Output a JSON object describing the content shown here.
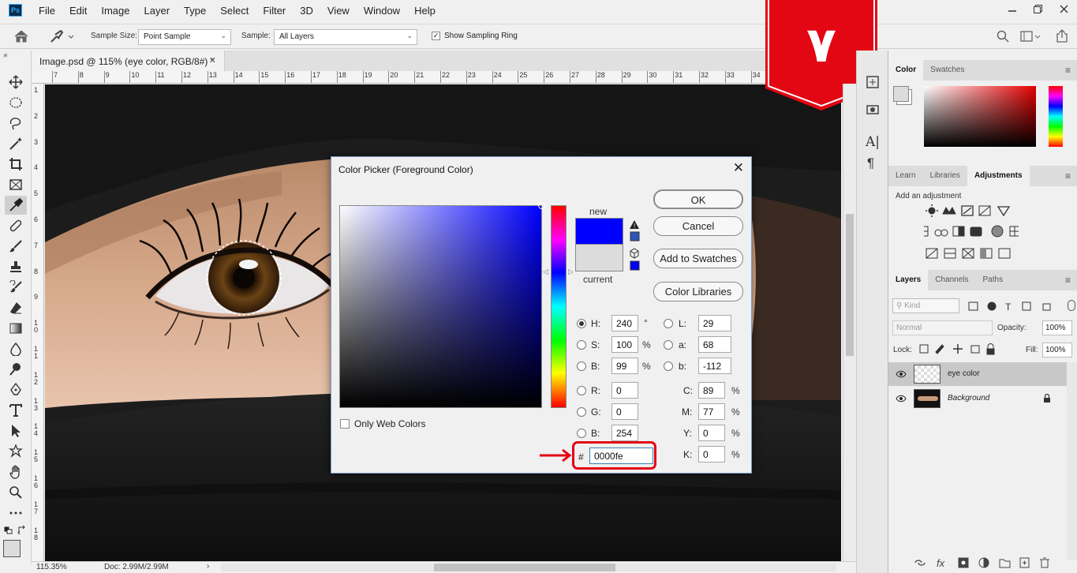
{
  "menubar": {
    "app_icon": "Ps",
    "items": [
      "File",
      "Edit",
      "Image",
      "Layer",
      "Type",
      "Select",
      "Filter",
      "3D",
      "View",
      "Window",
      "Help"
    ]
  },
  "options_bar": {
    "sample_size_label": "Sample Size:",
    "sample_size_value": "Point Sample",
    "sample_label": "Sample:",
    "sample_value": "All Layers",
    "show_ring_label": "Show Sampling Ring",
    "show_ring_checked": true
  },
  "document": {
    "tab_title": "Image.psd @ 115% (eye color, RGB/8#) *",
    "ruler_top": [
      "7",
      "8",
      "9",
      "10",
      "11",
      "12",
      "13",
      "14",
      "15",
      "16",
      "17",
      "18",
      "19",
      "20",
      "21",
      "22",
      "23",
      "24",
      "25",
      "26",
      "27",
      "28",
      "29",
      "30",
      "31",
      "32",
      "33",
      "34"
    ],
    "ruler_left": [
      "1",
      "2",
      "3",
      "4",
      "5",
      "6",
      "7",
      "8",
      "9",
      "10",
      "11",
      "12",
      "13",
      "14",
      "15",
      "16",
      "17",
      "18"
    ],
    "zoom": "115.35%",
    "doc_size": "Doc: 2.99M/2.99M"
  },
  "badge": {
    "text": "۷",
    "color": "#e30613"
  },
  "color_picker": {
    "title": "Color Picker (Foreground Color)",
    "ok": "OK",
    "cancel": "Cancel",
    "add_to_swatches": "Add to Swatches",
    "color_libraries": "Color Libraries",
    "new_label": "new",
    "current_label": "current",
    "new_color": "#0000fe",
    "current_color": "#dcdcdc",
    "only_web_colors": "Only Web Colors",
    "hsb": {
      "H": "240",
      "S": "100",
      "B": "99"
    },
    "rgb": {
      "R": "0",
      "G": "0",
      "B": "254"
    },
    "lab": {
      "L": "29",
      "a": "68",
      "b": "-112"
    },
    "cmyk": {
      "C": "89",
      "M": "77",
      "Y": "0",
      "K": "0"
    },
    "hex": "0000fe",
    "deg": "°",
    "pct": "%"
  },
  "panels": {
    "color_tabs": [
      "Color",
      "Swatches"
    ],
    "adj_tabs": [
      "Learn",
      "Libraries",
      "Adjustments"
    ],
    "add_adjustment": "Add an adjustment",
    "layers_tabs": [
      "Layers",
      "Channels",
      "Paths"
    ],
    "kind_placeholder": "Kind",
    "blend_mode": "Normal",
    "opacity_label": "Opacity:",
    "opacity_value": "100%",
    "lock_label": "Lock:",
    "fill_label": "Fill:",
    "fill_value": "100%",
    "layers": [
      {
        "name": "eye color",
        "selected": true
      },
      {
        "name": "Background",
        "selected": false
      }
    ]
  }
}
